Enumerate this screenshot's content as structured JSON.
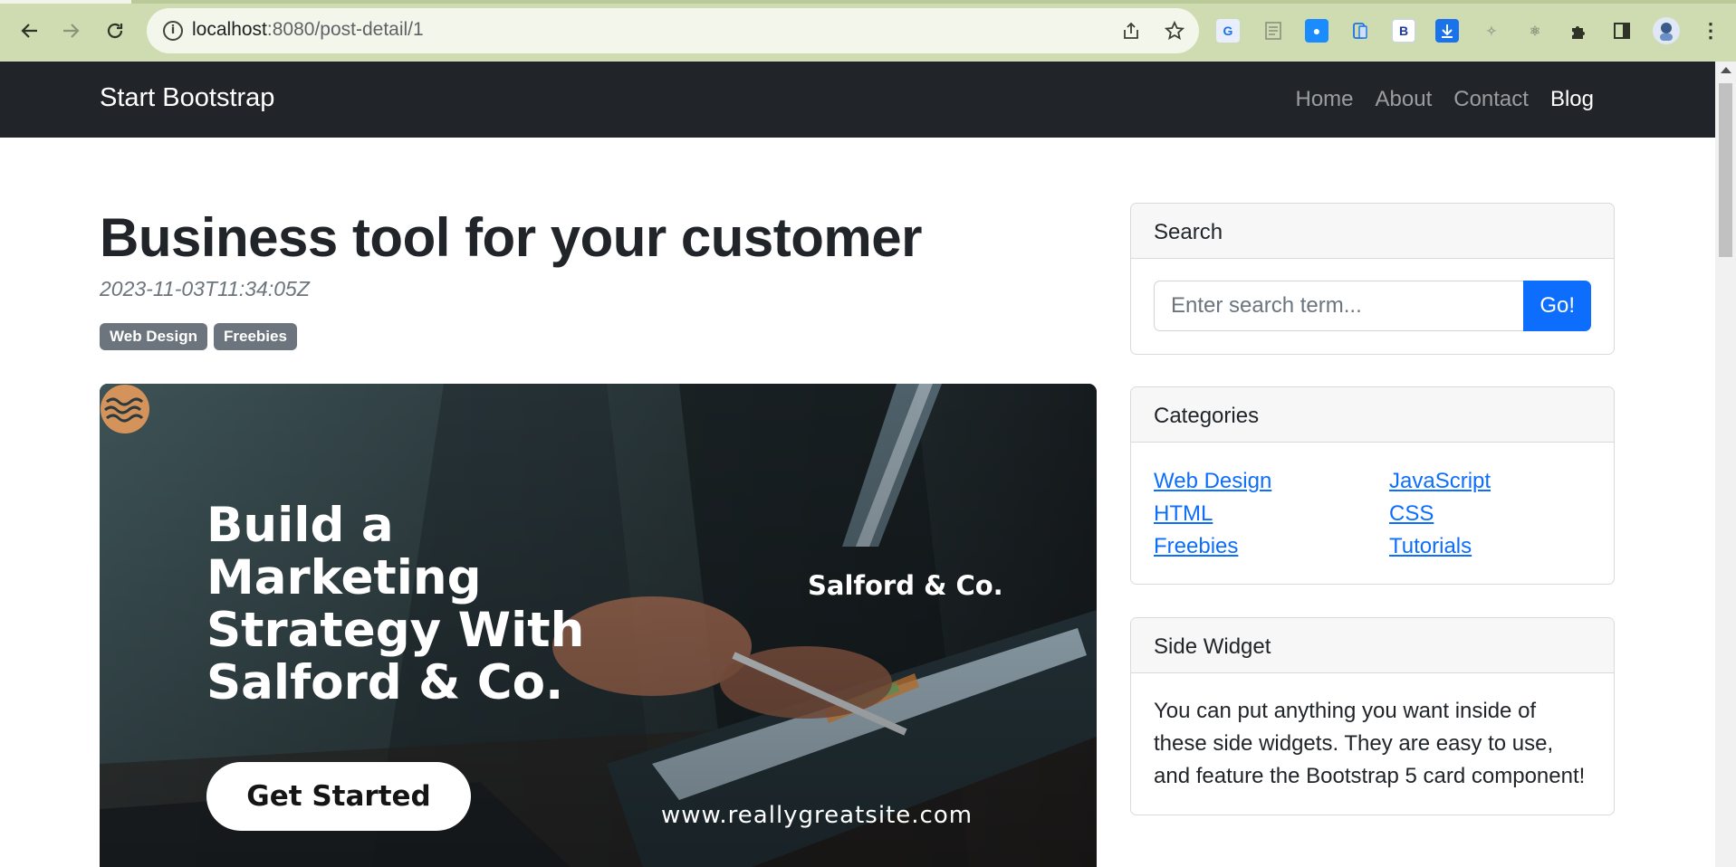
{
  "browser": {
    "url_host": "localhost",
    "url_path": ":8080/post-detail/1"
  },
  "navbar": {
    "brand": "Start Bootstrap",
    "links": [
      {
        "label": "Home",
        "active": false
      },
      {
        "label": "About",
        "active": false
      },
      {
        "label": "Contact",
        "active": false
      },
      {
        "label": "Blog",
        "active": true
      }
    ]
  },
  "post": {
    "title": "Business tool for your customer",
    "date": "2023-11-03T11:34:05Z",
    "tags": [
      "Web Design",
      "Freebies"
    ],
    "hero": {
      "headline_lines": [
        "Build a",
        "Marketing",
        "Strategy With",
        "Salford & Co."
      ],
      "brand": "Salford & Co.",
      "cta": "Get Started",
      "url": "www.reallygreatsite.com"
    }
  },
  "sidebar": {
    "search": {
      "title": "Search",
      "placeholder": "Enter search term...",
      "button": "Go!"
    },
    "categories": {
      "title": "Categories",
      "items": [
        "Web Design",
        "JavaScript",
        "HTML",
        "CSS",
        "Freebies",
        "Tutorials"
      ]
    },
    "side_widget": {
      "title": "Side Widget",
      "text": "You can put anything you want inside of these side widgets. They are easy to use, and feature the Bootstrap 5 card component!"
    }
  },
  "colors": {
    "navbar_bg": "#212529",
    "primary": "#0d6efd",
    "badge": "#6c757d",
    "chrome_bg": "#cfdcb2"
  }
}
